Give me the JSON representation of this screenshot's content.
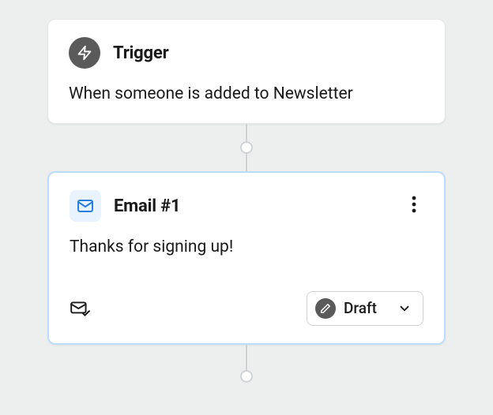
{
  "trigger": {
    "title": "Trigger",
    "description": "When someone is added to Newsletter"
  },
  "email": {
    "title": "Email #1",
    "subject": "Thanks for signing up!",
    "status": "Draft"
  },
  "colors": {
    "canvas_bg": "#edeeee",
    "card_bg": "#ffffff",
    "selected_border": "#bcdcff",
    "icon_dark": "#5a5a5a",
    "icon_light_bg": "#e9f3ff",
    "mail_stroke": "#2a7de1"
  }
}
